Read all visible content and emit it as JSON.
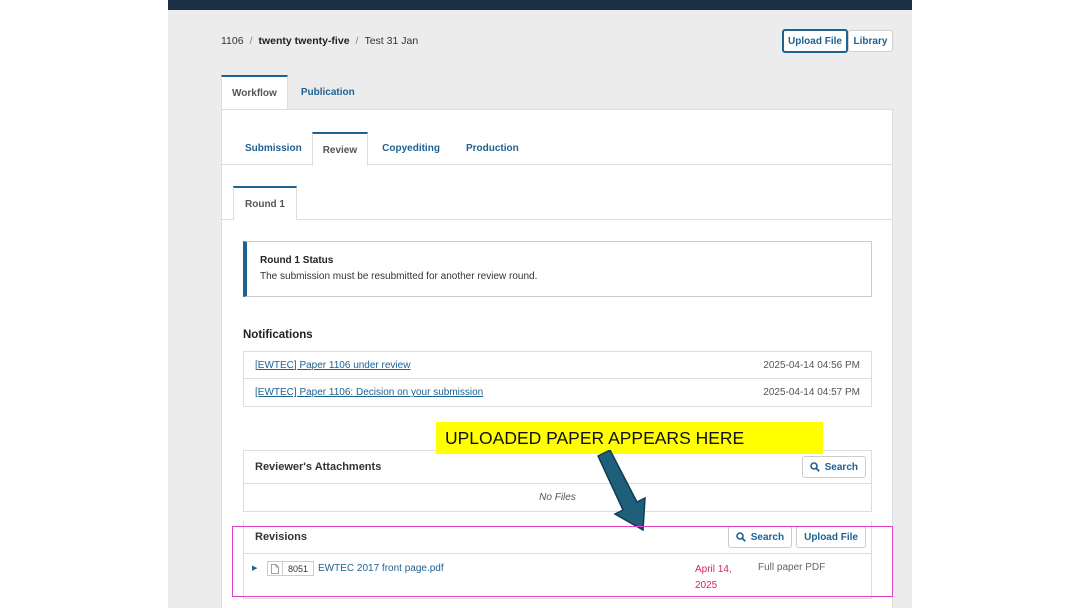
{
  "breadcrumb": {
    "id": "1106",
    "journal": "twenty twenty-five",
    "title": "Test 31 Jan"
  },
  "header_buttons": {
    "upload_file": "Upload File",
    "library": "Library"
  },
  "main_tabs": {
    "workflow": "Workflow",
    "publication": "Publication"
  },
  "stage_tabs": {
    "submission": "Submission",
    "review": "Review",
    "copyediting": "Copyediting",
    "production": "Production"
  },
  "round_tab": "Round 1",
  "round_status": {
    "title": "Round 1 Status",
    "text": "The submission must be resubmitted for another review round."
  },
  "notifications": {
    "heading": "Notifications",
    "items": [
      {
        "subject": "[EWTEC] Paper 1106 under review",
        "date": "2025-04-14 04:56 PM"
      },
      {
        "subject": "[EWTEC] Paper 1106: Decision on your submission",
        "date": "2025-04-14 04:57 PM"
      }
    ]
  },
  "reviewer_attachments": {
    "title": "Reviewer's Attachments",
    "search": "Search",
    "empty": "No Files"
  },
  "revisions": {
    "title": "Revisions",
    "search": "Search",
    "upload": "Upload File",
    "files": [
      {
        "id": "8051",
        "name": "EWTEC 2017 front page.pdf",
        "date": "April 14, 2025",
        "type": "Full paper PDF"
      }
    ]
  },
  "annotation": {
    "text": "UPLOADED PAPER APPEARS HERE"
  },
  "colors": {
    "accent": "#1e6292",
    "date_pink": "#d6246e",
    "highlight": "#e040c8",
    "annotation_bg": "#ffff00",
    "arrow": "#1f5f7a"
  }
}
